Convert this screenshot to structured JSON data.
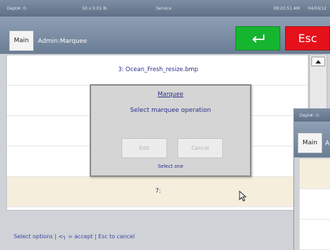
{
  "status_bar": {
    "dept": "Dept#: 0:",
    "scale": "50 x 0.01 lb",
    "mode": "Service",
    "time": "08:20:51 AM",
    "date": "04/04/12"
  },
  "header": {
    "main_button": "Main",
    "title": "Admin:Marquee",
    "esc_button": "Esc",
    "enter_icon": "enter-return-icon"
  },
  "list": {
    "rows": [
      {
        "label": "3: Ocean_Fresh_resize.bmp"
      },
      {
        "label": ""
      },
      {
        "label": ""
      },
      {
        "label": ""
      },
      {
        "label": "7:"
      }
    ]
  },
  "modal": {
    "title": "Marquee",
    "message": "Select marquee operation",
    "edit_button": "Edit",
    "cancel_button": "Cancel",
    "footer": "Select one"
  },
  "footer": {
    "instructions": "Select options | <┐ = accept | Esc to cancel"
  },
  "second_window": {
    "dept": "Dept#: 0:",
    "main_button": "Main",
    "title_fragment": "A"
  },
  "colors": {
    "accept": "#16b52f",
    "escape": "#e6111a",
    "highlight_row": "#f5eedd",
    "text_blue": "#2a2e8a"
  }
}
